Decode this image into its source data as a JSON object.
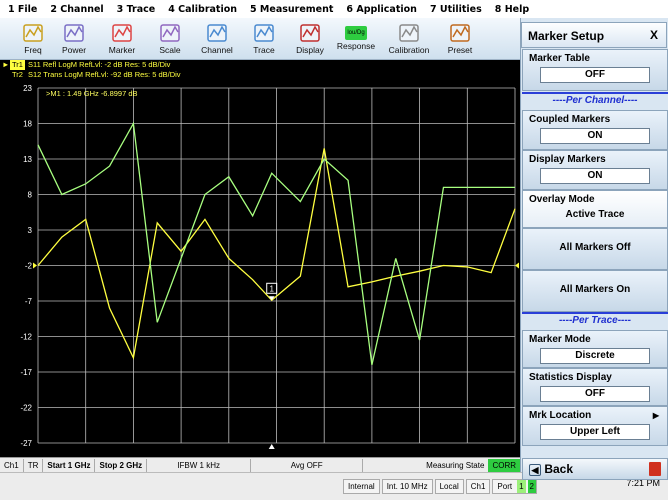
{
  "menu": [
    "1 File",
    "2 Channel",
    "3 Trace",
    "4 Calibration",
    "5 Measurement",
    "6 Application",
    "7 Utilities",
    "8 Help"
  ],
  "toolbar": [
    {
      "label": "Freq",
      "icon": "freq-icon"
    },
    {
      "label": "Power",
      "icon": "power-icon"
    },
    {
      "label": "Marker",
      "icon": "marker-icon"
    },
    {
      "label": "Scale",
      "icon": "scale-icon"
    },
    {
      "label": "Channel",
      "icon": "channel-icon"
    },
    {
      "label": "Trace",
      "icon": "trace-icon"
    },
    {
      "label": "Display",
      "icon": "display-icon"
    },
    {
      "label": "Response",
      "icon": "response-icon"
    },
    {
      "label": "Calibration",
      "icon": "calibration-icon"
    },
    {
      "label": "Preset",
      "icon": "preset-icon"
    }
  ],
  "response_badge": "lou/Dg",
  "trace_header": {
    "tr1_label": "Tr1",
    "tr1_text": "S11 Refl LogM RefLvl: -2  dB Res: 5  dB/Div",
    "tr2_label": "Tr2",
    "tr2_text": "S12 Trans LogM RefLvl: -92  dB Res: 5  dB/Div"
  },
  "marker_readout": ">M1 : 1.49 GHz -6.8997 dB",
  "marker_tag": "1",
  "chart_data": {
    "type": "line",
    "y_ticks": [
      23,
      18,
      13,
      8,
      3,
      -2,
      -7,
      -12,
      -17,
      -22,
      -27
    ],
    "ylim": [
      -27,
      23
    ],
    "xlim": [
      1,
      2
    ],
    "grid": true,
    "series": [
      {
        "name": "Tr1",
        "color": "#ffff40",
        "x": [
          1.0,
          1.05,
          1.1,
          1.15,
          1.2,
          1.25,
          1.3,
          1.35,
          1.4,
          1.45,
          1.49,
          1.55,
          1.6,
          1.65,
          1.7,
          1.75,
          1.8,
          1.85,
          1.9,
          1.95,
          2.0
        ],
        "values": [
          -2,
          2,
          4.5,
          -8,
          -15,
          4,
          0,
          4.5,
          -1,
          -4,
          -6.9,
          -3.5,
          14.5,
          -5,
          -4.3,
          -3.5,
          -2.8,
          -2,
          -2.2,
          -3,
          6
        ]
      },
      {
        "name": "Tr2",
        "color": "#a8ff80",
        "x": [
          1.0,
          1.05,
          1.1,
          1.15,
          1.2,
          1.25,
          1.3,
          1.35,
          1.4,
          1.45,
          1.49,
          1.55,
          1.6,
          1.65,
          1.7,
          1.75,
          1.8,
          1.85,
          1.9,
          1.95,
          2.0
        ],
        "values": [
          15,
          8,
          9.5,
          12,
          18,
          -10,
          -1,
          8,
          10.5,
          5,
          11,
          7,
          13,
          10,
          -16,
          -1,
          -12.5,
          9,
          9,
          9,
          9
        ]
      }
    ]
  },
  "status": {
    "ch": "Ch1",
    "tr": "TR",
    "start": "Start 1 GHz",
    "stop": "Stop 2 GHz",
    "ifbw": "IFBW 1 kHz",
    "avg": "Avg OFF",
    "meas_state_label": "Measuring State",
    "corr": "CORR"
  },
  "status2": {
    "internal": "Internal",
    "int_ref": "Int. 10 MHz",
    "local": "Local",
    "ch": "Ch1",
    "port": "Port",
    "port1": "1",
    "port2": "2",
    "clock": "7:21 PM"
  },
  "panel": {
    "title": "Marker Setup",
    "close": "X",
    "marker_table_label": "Marker Table",
    "marker_table_value": "OFF",
    "per_channel": "----Per Channel----",
    "coupled_label": "Coupled Markers",
    "coupled_value": "ON",
    "display_markers_label": "Display Markers",
    "display_markers_value": "ON",
    "overlay_label": "Overlay Mode",
    "overlay_value": "Active Trace",
    "all_off": "All Markers Off",
    "all_on": "All Markers On",
    "per_trace": "----Per Trace----",
    "marker_mode_label": "Marker Mode",
    "marker_mode_value": "Discrete",
    "stats_label": "Statistics Display",
    "stats_value": "OFF",
    "mrk_location_label": "Mrk Location",
    "mrk_location_value": "Upper Left",
    "back": "Back"
  }
}
